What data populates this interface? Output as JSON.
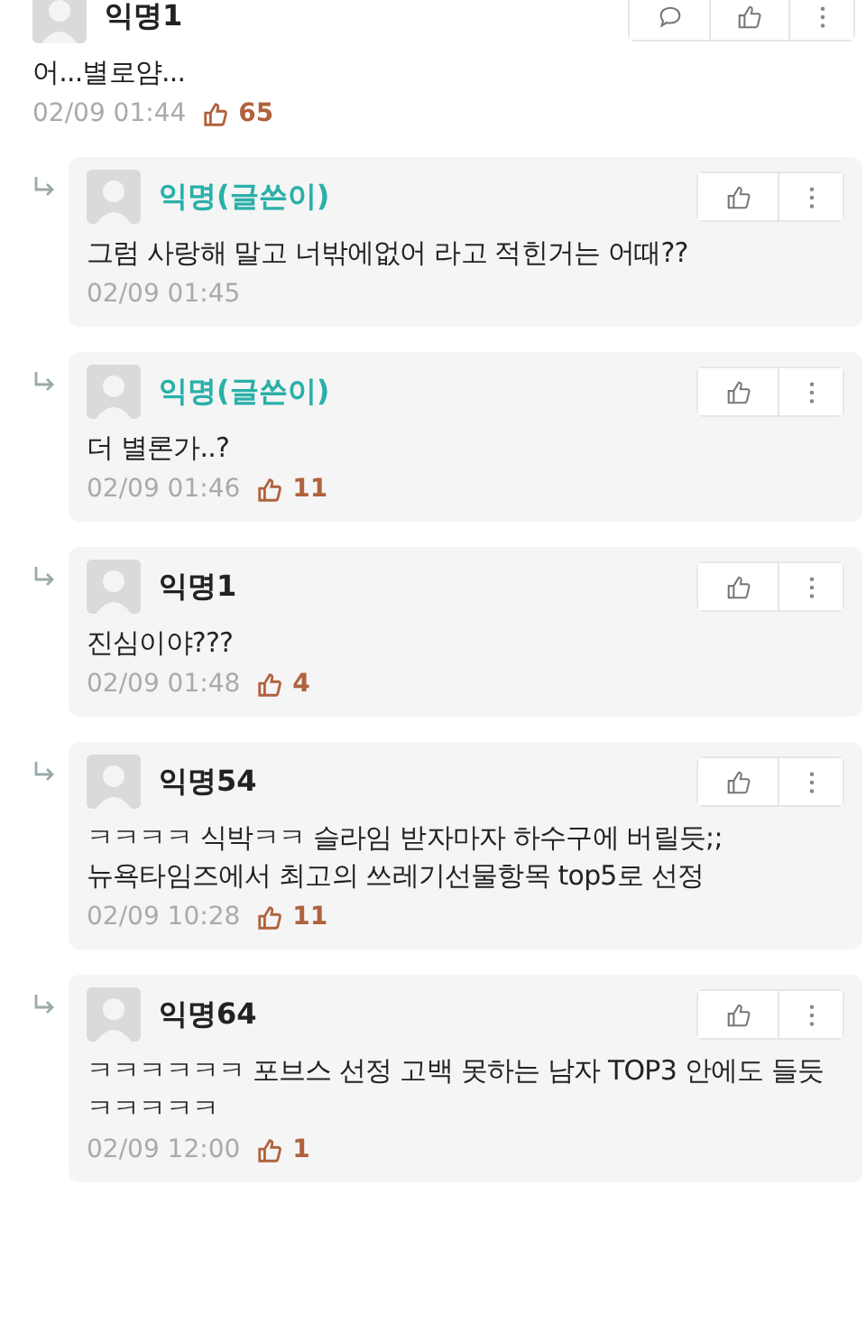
{
  "comments": [
    {
      "kind": "comment",
      "author": "익명1",
      "is_writer": false,
      "text": "어...별로얌...",
      "time": "02/09 01:44",
      "likes": "65"
    },
    {
      "kind": "reply",
      "author": "익명(글쓴이)",
      "is_writer": true,
      "text": "그럼 사랑해 말고 너밖에없어 라고 적힌거는 어때??",
      "time": "02/09 01:45"
    },
    {
      "kind": "reply",
      "author": "익명(글쓴이)",
      "is_writer": true,
      "text": "더 별론가..?",
      "time": "02/09 01:46",
      "likes": "11"
    },
    {
      "kind": "reply",
      "author": "익명1",
      "is_writer": false,
      "text": "진심이야???",
      "time": "02/09 01:48",
      "likes": "4"
    },
    {
      "kind": "reply",
      "author": "익명54",
      "is_writer": false,
      "text": "ㅋㅋㅋㅋ 식박ㅋㅋ 슬라임 받자마자 하수구에 버릴듯;; 뉴욕타임즈에서 최고의 쓰레기선물항목 top5로 선정",
      "time": "02/09 10:28",
      "likes": "11"
    },
    {
      "kind": "reply",
      "author": "익명64",
      "is_writer": false,
      "text": "ㅋㅋㅋㅋㅋㅋ 포브스 선정 고백 못하는 남자 TOP3 안에도 들듯 ㅋㅋㅋㅋㅋ",
      "time": "02/09 12:00",
      "likes": "1"
    }
  ]
}
